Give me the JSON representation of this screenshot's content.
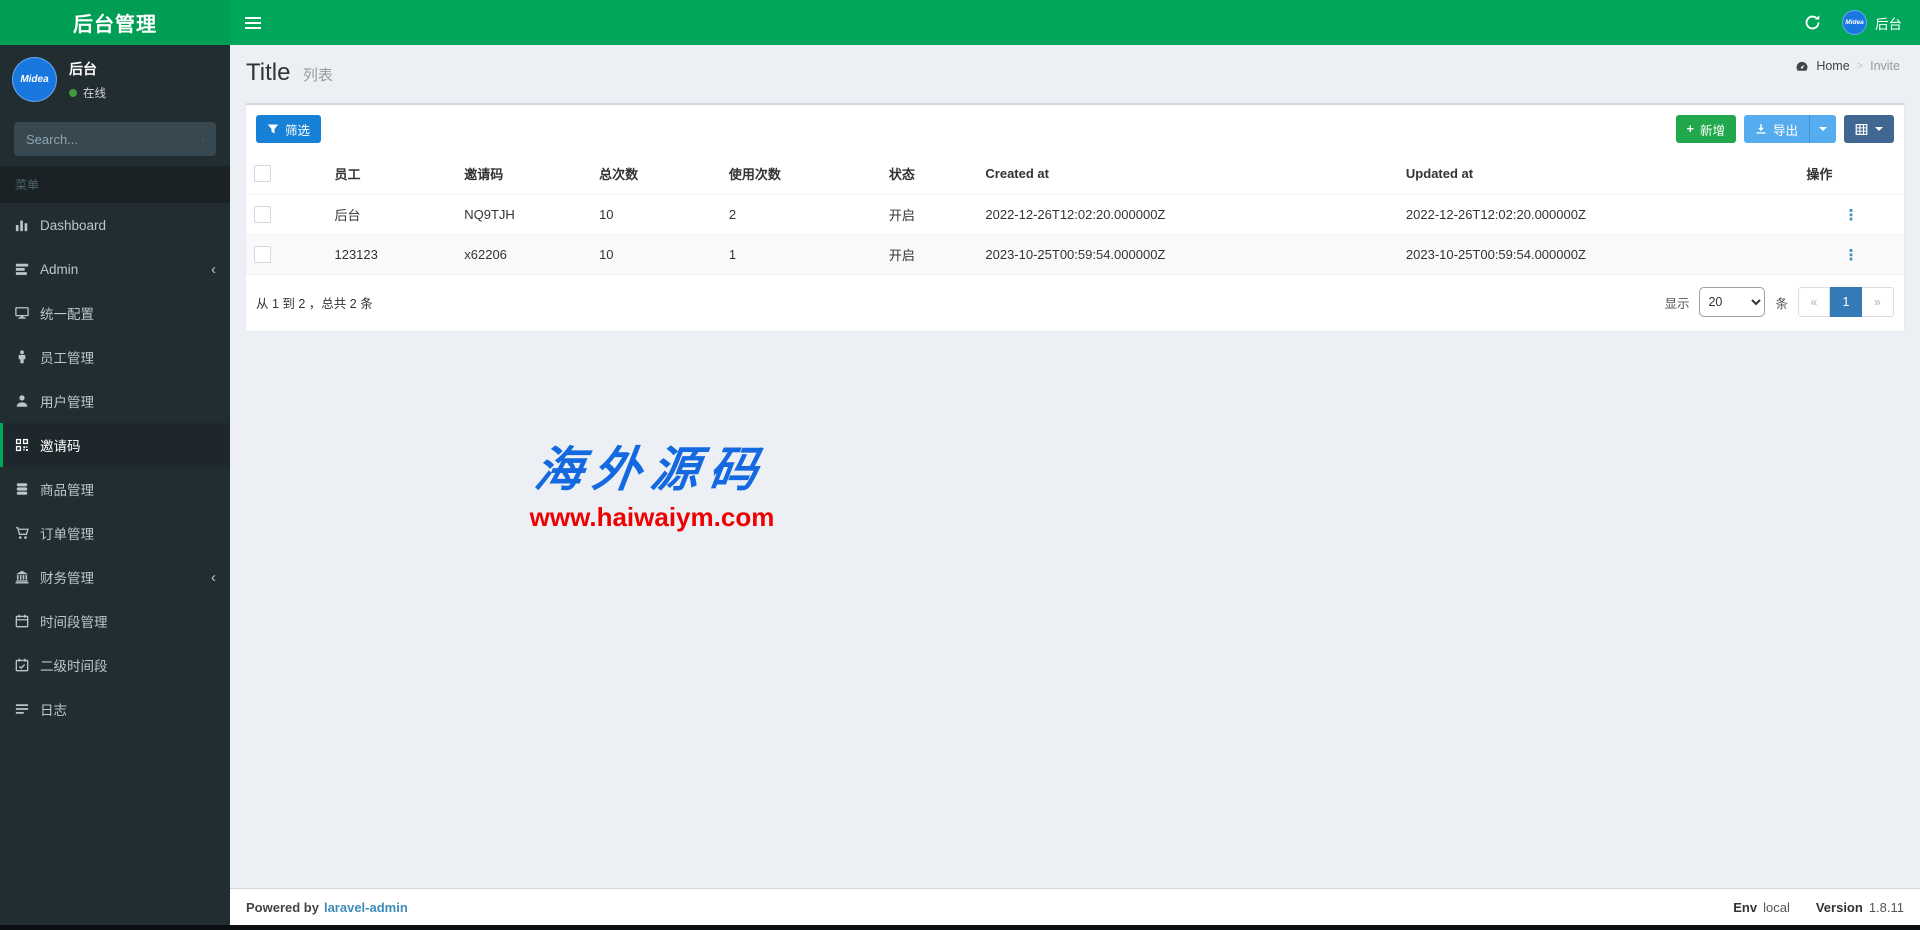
{
  "topbar": {
    "brand": "后台管理",
    "user_name": "后台",
    "avatar_text": "Midea"
  },
  "sidebar": {
    "user": {
      "name": "后台",
      "status": "在线",
      "avatar_text": "Midea"
    },
    "search_placeholder": "Search...",
    "section_label": "菜单",
    "items": [
      {
        "label": "Dashboard",
        "icon": "bar-chart-icon"
      },
      {
        "label": "Admin",
        "icon": "tasks-icon",
        "has_children": true
      },
      {
        "label": "统一配置",
        "icon": "desktop-icon"
      },
      {
        "label": "员工管理",
        "icon": "male-icon"
      },
      {
        "label": "用户管理",
        "icon": "user-icon"
      },
      {
        "label": "邀请码",
        "icon": "qrcode-icon",
        "active": true
      },
      {
        "label": "商品管理",
        "icon": "database-icon"
      },
      {
        "label": "订单管理",
        "icon": "cart-icon"
      },
      {
        "label": "财务管理",
        "icon": "bank-icon",
        "has_children": true
      },
      {
        "label": "时间段管理",
        "icon": "calendar-icon"
      },
      {
        "label": "二级时间段",
        "icon": "calendar-check-icon"
      },
      {
        "label": "日志",
        "icon": "log-icon"
      }
    ],
    "collapse_arrow": "‹"
  },
  "header": {
    "title": "Title",
    "subtitle": "列表",
    "breadcrumb_home": "Home",
    "breadcrumb_sep": ">",
    "breadcrumb_current": "Invite"
  },
  "toolbar": {
    "filter_label": "筛选",
    "create_label": "新增",
    "create_plus": "+",
    "export_label": "导出"
  },
  "table": {
    "columns": [
      "员工",
      "邀请码",
      "总次数",
      "使用次数",
      "状态",
      "Created at",
      "Updated at",
      "操作"
    ],
    "rows": [
      [
        "后台",
        "NQ9TJH",
        "10",
        "2",
        "开启",
        "2022-12-26T12:02:20.000000Z",
        "2022-12-26T12:02:20.000000Z"
      ],
      [
        "123123",
        "x62206",
        "10",
        "1",
        "开启",
        "2023-10-25T00:59:54.000000Z",
        "2023-10-25T00:59:54.000000Z"
      ]
    ],
    "action_glyph": "⋮"
  },
  "pagination": {
    "summary": "从 1 到 2 ，总共 2 条",
    "show_label": "显示",
    "per_page": "20",
    "unit_label": "条",
    "prev": "«",
    "page": "1",
    "next": "»"
  },
  "watermark": {
    "line1": "海外源码",
    "line2": "www.haiwaiym.com"
  },
  "footer": {
    "powered_by": "Powered by",
    "link": "laravel-admin",
    "env_label": "Env",
    "env_value": "local",
    "version_label": "Version",
    "version_value": "1.8.11"
  },
  "colors": {
    "navbar_green": "#00a65a",
    "sidebar_dark": "#222d32",
    "active_border_green": "#00a65a",
    "filter_blue": "#1781d8",
    "create_green": "#21a84c",
    "export_blue": "#55acee",
    "columns_steel": "#3f6791",
    "pager_active_blue": "#337ab7",
    "link_blue": "#3c8dbc",
    "watermark_blue": "#1469e0",
    "watermark_red": "#ee0000"
  }
}
